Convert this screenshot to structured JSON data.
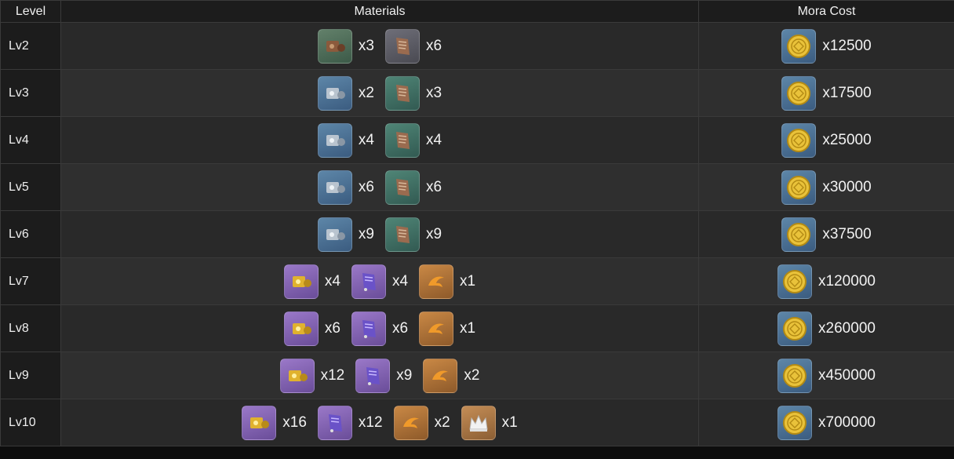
{
  "headers": {
    "level": "Level",
    "materials": "Materials",
    "mora": "Mora Cost"
  },
  "colors": {
    "rarity_green": "#4e6e58",
    "rarity_gray": "#5c5c64",
    "rarity_blue": "#4b7398",
    "rarity_purple": "#8465b3",
    "rarity_orange": "#b07840"
  },
  "rows": [
    {
      "level": "Lv2",
      "materials": [
        {
          "icon": "brown-mechanism-icon",
          "rarity": "green",
          "qty": "x3"
        },
        {
          "icon": "scroll-book-icon",
          "rarity": "gray",
          "qty": "x6"
        }
      ],
      "mora": "x12500"
    },
    {
      "level": "Lv3",
      "materials": [
        {
          "icon": "silver-mechanism-icon",
          "rarity": "blue",
          "qty": "x2"
        },
        {
          "icon": "scroll-book-icon",
          "rarity": "teal",
          "qty": "x3"
        }
      ],
      "mora": "x17500"
    },
    {
      "level": "Lv4",
      "materials": [
        {
          "icon": "silver-mechanism-icon",
          "rarity": "blue",
          "qty": "x4"
        },
        {
          "icon": "scroll-book-icon",
          "rarity": "teal",
          "qty": "x4"
        }
      ],
      "mora": "x25000"
    },
    {
      "level": "Lv5",
      "materials": [
        {
          "icon": "silver-mechanism-icon",
          "rarity": "blue",
          "qty": "x6"
        },
        {
          "icon": "scroll-book-icon",
          "rarity": "teal",
          "qty": "x6"
        }
      ],
      "mora": "x30000"
    },
    {
      "level": "Lv6",
      "materials": [
        {
          "icon": "silver-mechanism-icon",
          "rarity": "blue",
          "qty": "x9"
        },
        {
          "icon": "scroll-book-icon",
          "rarity": "teal",
          "qty": "x9"
        }
      ],
      "mora": "x37500"
    },
    {
      "level": "Lv7",
      "materials": [
        {
          "icon": "gold-mechanism-icon",
          "rarity": "purple",
          "qty": "x4"
        },
        {
          "icon": "purple-book-icon",
          "rarity": "purple",
          "qty": "x4"
        },
        {
          "icon": "claw-icon",
          "rarity": "orange",
          "qty": "x1"
        }
      ],
      "mora": "x120000"
    },
    {
      "level": "Lv8",
      "materials": [
        {
          "icon": "gold-mechanism-icon",
          "rarity": "purple",
          "qty": "x6"
        },
        {
          "icon": "purple-book-icon",
          "rarity": "purple",
          "qty": "x6"
        },
        {
          "icon": "claw-icon",
          "rarity": "orange",
          "qty": "x1"
        }
      ],
      "mora": "x260000"
    },
    {
      "level": "Lv9",
      "materials": [
        {
          "icon": "gold-mechanism-icon",
          "rarity": "purple",
          "qty": "x12"
        },
        {
          "icon": "purple-book-icon",
          "rarity": "purple",
          "qty": "x9"
        },
        {
          "icon": "claw-icon",
          "rarity": "orange",
          "qty": "x2"
        }
      ],
      "mora": "x450000"
    },
    {
      "level": "Lv10",
      "materials": [
        {
          "icon": "gold-mechanism-icon",
          "rarity": "purple",
          "qty": "x16"
        },
        {
          "icon": "purple-book-icon",
          "rarity": "purple",
          "qty": "x12"
        },
        {
          "icon": "claw-icon",
          "rarity": "orange",
          "qty": "x2"
        },
        {
          "icon": "crown-icon",
          "rarity": "crown",
          "qty": "x1"
        }
      ],
      "mora": "x700000"
    }
  ]
}
